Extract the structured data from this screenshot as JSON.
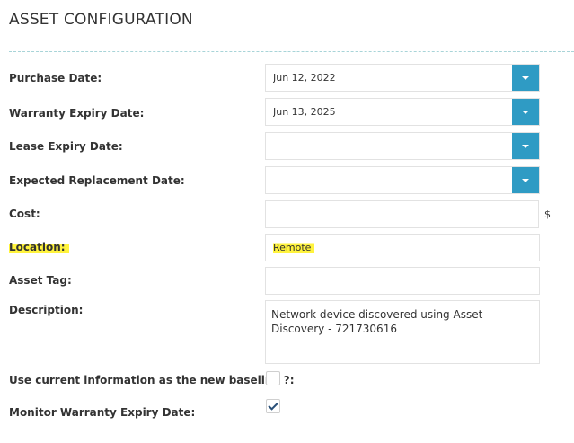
{
  "title": "ASSET CONFIGURATION",
  "fields": {
    "purchase_date": {
      "label": "Purchase Date:",
      "value": "Jun 12, 2022"
    },
    "warranty_expiry": {
      "label": "Warranty Expiry Date:",
      "value": "Jun 13, 2025"
    },
    "lease_expiry": {
      "label": "Lease Expiry Date:",
      "value": ""
    },
    "expected_replacement": {
      "label": "Expected Replacement Date:",
      "value": ""
    },
    "cost": {
      "label": "Cost:",
      "value": "",
      "unit": "$"
    },
    "location": {
      "label": "Location:",
      "value": "Remote"
    },
    "asset_tag": {
      "label": "Asset Tag:",
      "value": ""
    },
    "description": {
      "label": "Description:",
      "value": "Network device discovered using Asset Discovery - 721730616"
    },
    "use_current_baseline": {
      "label": "Use current information as the new baseline ?:",
      "checked": false
    },
    "monitor_warranty": {
      "label": "Monitor Warranty Expiry Date:",
      "checked": true
    }
  },
  "colors": {
    "accent": "#2f9bc4",
    "highlight": "#fff33d",
    "divider": "#a8d4d8",
    "check": "#2a5078"
  },
  "icons": {
    "date_dropdown": "chevron-down-icon",
    "checkmark": "checkmark-icon"
  }
}
